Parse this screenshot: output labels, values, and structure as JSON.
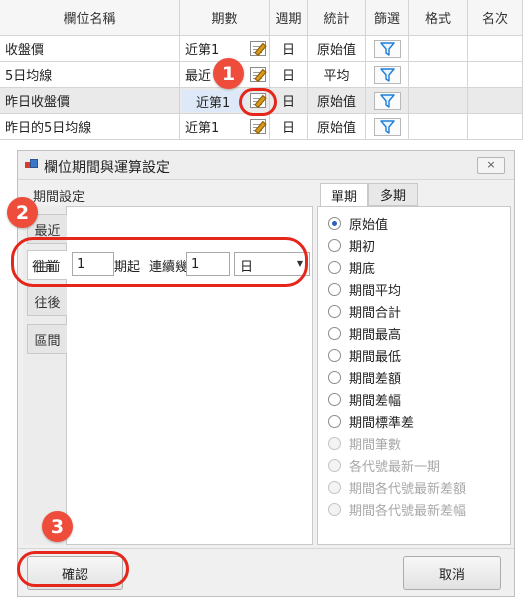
{
  "grid": {
    "headers": [
      "欄位名稱",
      "期數",
      "週期",
      "統計",
      "篩選",
      "格式",
      "名次"
    ],
    "rows": [
      {
        "name": "收盤價",
        "period": "近第1",
        "cycle": "日",
        "stat": "原始值"
      },
      {
        "name": "5日均線",
        "period": "最近",
        "cycle": "日",
        "stat": "平均"
      },
      {
        "name": "昨日收盤價",
        "period": "近第1",
        "cycle": "日",
        "stat": "原始值"
      },
      {
        "name": "昨日的5日均線",
        "period": "近第1",
        "cycle": "日",
        "stat": "原始值"
      }
    ],
    "edit_icon": "edit-pencil-icon",
    "filter_icon": "funnel-icon",
    "filter_color": "#1e7fd8"
  },
  "dialog": {
    "title": "欄位期間與運算設定",
    "close_label": "×",
    "group_label": "期間設定",
    "vtabs": [
      "最近",
      "往前",
      "往後",
      "區間"
    ],
    "range_row": {
      "prefix": "往前",
      "start_value": "1",
      "start_suffix": "期起",
      "count_label": "連續幾",
      "count_value": "1",
      "unit_value": "日"
    },
    "htabs": [
      "單期",
      "多期"
    ],
    "options": [
      {
        "label": "原始值",
        "checked": true,
        "enabled": true
      },
      {
        "label": "期初",
        "checked": false,
        "enabled": true
      },
      {
        "label": "期底",
        "checked": false,
        "enabled": true
      },
      {
        "label": "期間平均",
        "checked": false,
        "enabled": true
      },
      {
        "label": "期間合計",
        "checked": false,
        "enabled": true
      },
      {
        "label": "期間最高",
        "checked": false,
        "enabled": true
      },
      {
        "label": "期間最低",
        "checked": false,
        "enabled": true
      },
      {
        "label": "期間差額",
        "checked": false,
        "enabled": true
      },
      {
        "label": "期間差幅",
        "checked": false,
        "enabled": true
      },
      {
        "label": "期間標準差",
        "checked": false,
        "enabled": true
      },
      {
        "label": "期間筆數",
        "checked": false,
        "enabled": false
      },
      {
        "label": "各代號最新一期",
        "checked": false,
        "enabled": false
      },
      {
        "label": "期間各代號最新差額",
        "checked": false,
        "enabled": false
      },
      {
        "label": "期間各代號最新差幅",
        "checked": false,
        "enabled": false
      }
    ],
    "confirm_label": "確認",
    "cancel_label": "取消"
  },
  "annotations": {
    "badges": [
      "1",
      "2",
      "3"
    ],
    "color": "#e5261b"
  }
}
